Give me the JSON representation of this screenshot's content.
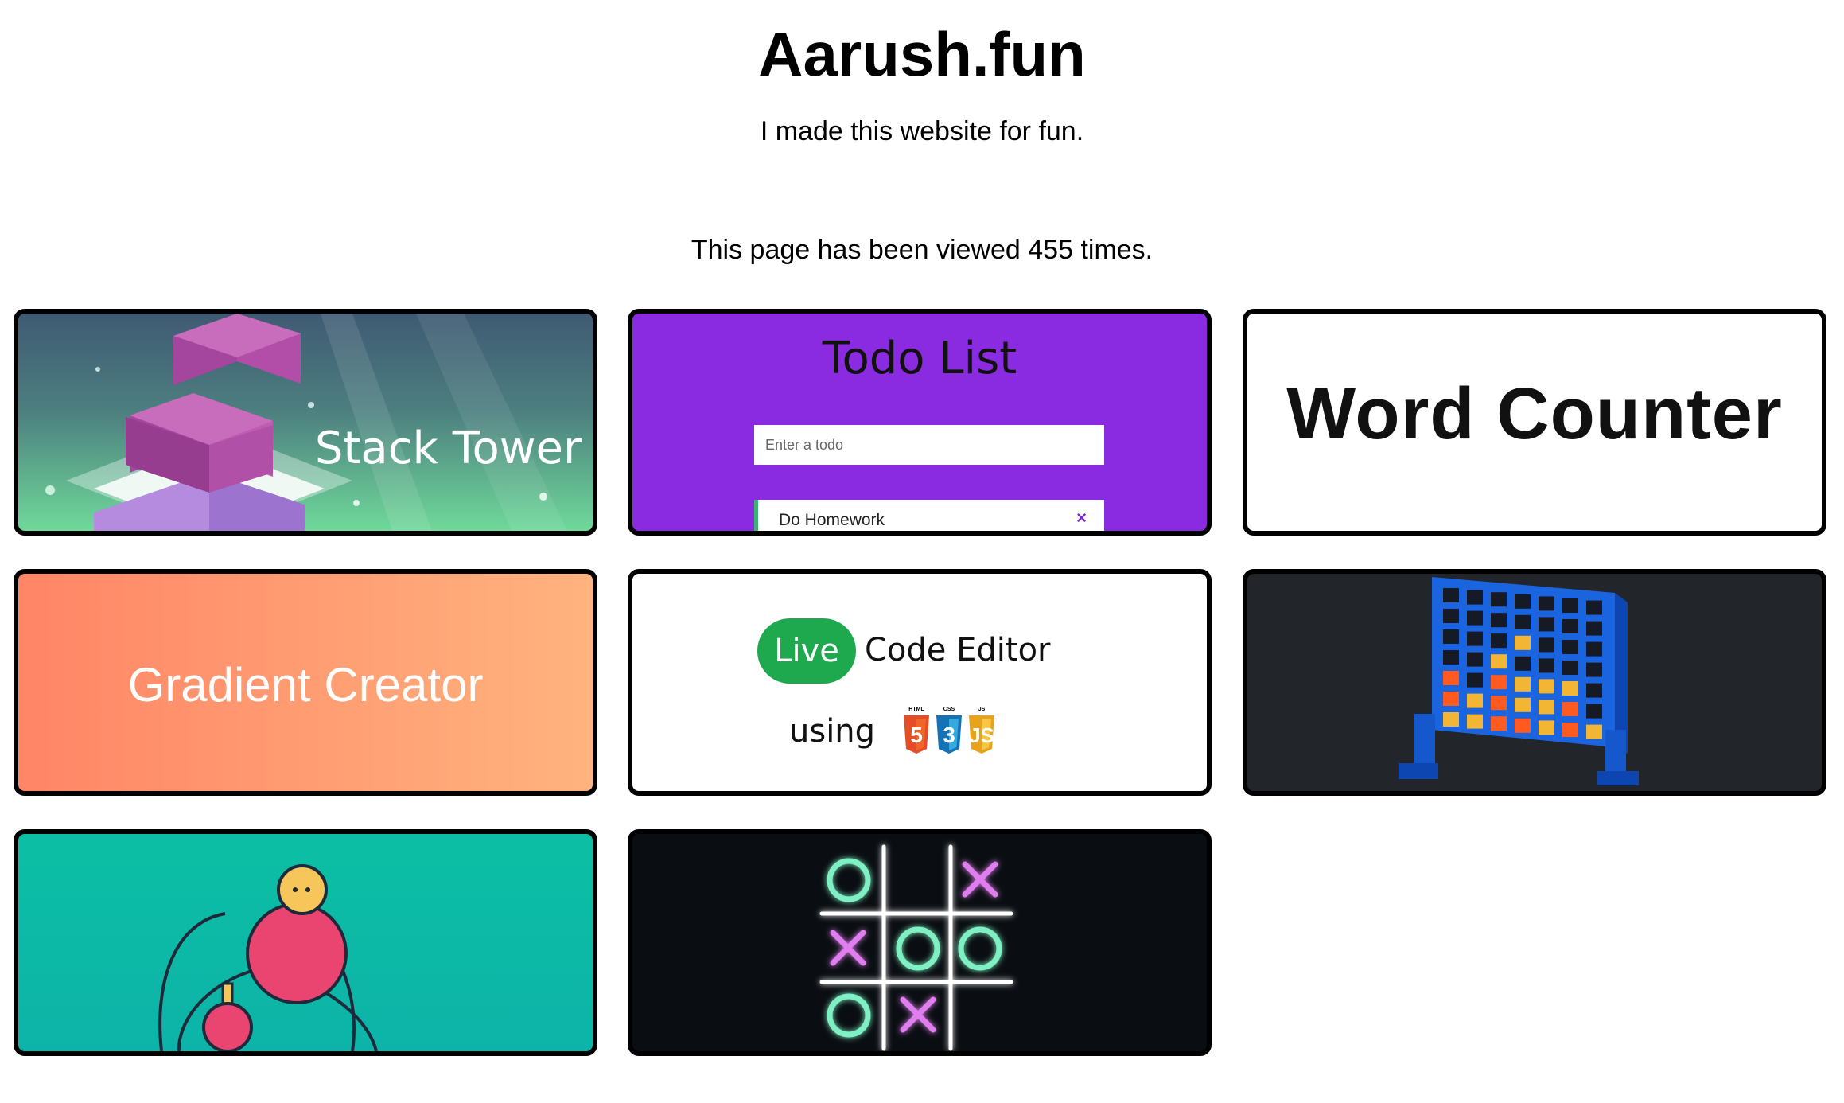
{
  "header": {
    "title": "Aarush.fun",
    "subtitle": "I made this website for fun.",
    "views_text": "This page has been viewed 455 times."
  },
  "cards": {
    "stack_tower": {
      "label": "Stack Tower"
    },
    "todo": {
      "title": "Todo List",
      "input_placeholder": "Enter a todo",
      "item_text": "Do Homework",
      "item_delete": "×"
    },
    "word_counter": {
      "label": "Word Counter"
    },
    "gradient_creator": {
      "label": "Gradient Creator"
    },
    "live_editor": {
      "pill": "Live",
      "text": "Code Editor",
      "using": "using",
      "badges": [
        "HTML",
        "CSS",
        "JS"
      ]
    },
    "connect_four": {
      "icon": "connect-four-icon"
    },
    "balls": {
      "icon": "bouncing-balls-icon"
    },
    "tic_tac_toe": {
      "icon": "tic-tac-toe-icon"
    }
  },
  "colors": {
    "todo_bg": "#8a2be2",
    "live_green": "#1ea94f",
    "gradient_start": "#ff8566",
    "gradient_end": "#ffb37e",
    "teal": "#0cbfa4"
  }
}
